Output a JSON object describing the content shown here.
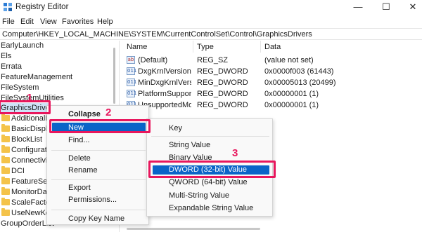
{
  "window": {
    "title": "Registry Editor",
    "min_glyph": "—",
    "max_glyph": "☐",
    "close_glyph": "✕"
  },
  "menu": [
    "File",
    "Edit",
    "View",
    "Favorites",
    "Help"
  ],
  "address": "Computer\\HKEY_LOCAL_MACHINE\\SYSTEM\\CurrentControlSet\\Control\\GraphicsDrivers",
  "tree": {
    "items": [
      "EarlyLaunch",
      "Els",
      "Errata",
      "FeatureManagement",
      "FileSystem",
      "FileSystemUtilities",
      "GraphicsDrivers",
      "AdditionalModeLists",
      "BasicDisplay",
      "BlockList",
      "Configuration",
      "Connectivity",
      "DCI",
      "FeatureSetUsage",
      "MonitorDataStore",
      "ScaleFactors",
      "UseNewKey",
      "GroupOrderList"
    ]
  },
  "list": {
    "columns": [
      "Name",
      "Type",
      "Data"
    ],
    "rows": [
      {
        "icon": "string-value-icon",
        "name": "(Default)",
        "type": "REG_SZ",
        "data": "(value not set)"
      },
      {
        "icon": "binary-value-icon",
        "name": "DxgKrnlVersion",
        "type": "REG_DWORD",
        "data": "0x0000f003 (61443)"
      },
      {
        "icon": "binary-value-icon",
        "name": "MinDxgKrnlVersion",
        "type": "REG_DWORD",
        "data": "0x00005013 (20499)"
      },
      {
        "icon": "binary-value-icon",
        "name": "PlatformSupportMiracast",
        "type": "REG_DWORD",
        "data": "0x00000001 (1)"
      },
      {
        "icon": "binary-value-icon",
        "name": "UnsupportedMonitorModesAllowed",
        "type": "REG_DWORD",
        "data": "0x00000001 (1)"
      }
    ]
  },
  "context_menu": {
    "collapse": "Collapse",
    "new": "New",
    "find": "Find...",
    "delete": "Delete",
    "rename": "Rename",
    "export": "Export",
    "permissions": "Permissions...",
    "copy_key_name": "Copy Key Name"
  },
  "submenu": {
    "key": "Key",
    "string_value": "String Value",
    "binary_value": "Binary Value",
    "dword_value": "DWORD (32-bit) Value",
    "qword_value": "QWORD (64-bit) Value",
    "multi_string_value": "Multi-String Value",
    "expandable_string_value": "Expandable String Value"
  },
  "annotations": {
    "step1": "1",
    "step2": "2",
    "step3": "3",
    "accent_color": "#e8175d",
    "highlight_color": "#0a64c8"
  },
  "icons": {
    "string": "ab",
    "binary": "011"
  }
}
